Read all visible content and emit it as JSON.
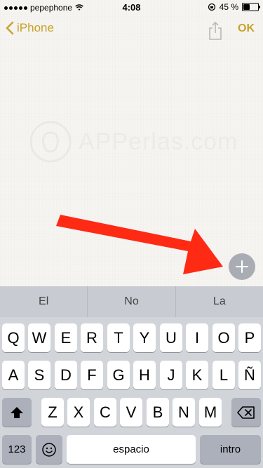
{
  "status_bar": {
    "carrier": "pepephone",
    "time": "4:08",
    "battery": "45 %"
  },
  "nav": {
    "back_label": "iPhone",
    "ok_label": "OK"
  },
  "watermark": {
    "text": "APPerlas.com"
  },
  "suggestions": [
    "El",
    "No",
    "La"
  ],
  "keyboard": {
    "row1": [
      "Q",
      "W",
      "E",
      "R",
      "T",
      "Y",
      "U",
      "I",
      "O",
      "P"
    ],
    "row2": [
      "A",
      "S",
      "D",
      "F",
      "G",
      "H",
      "J",
      "K",
      "L",
      "Ñ"
    ],
    "row3": [
      "Z",
      "X",
      "C",
      "V",
      "B",
      "N",
      "M"
    ],
    "numbers_label": "123",
    "space_label": "espacio",
    "return_label": "intro"
  },
  "icons": {
    "back": "chevron-left-icon",
    "share": "share-icon",
    "add": "plus-icon",
    "shift": "shift-icon",
    "delete": "delete-icon",
    "emoji": "emoji-icon"
  },
  "colors": {
    "accent": "#c8a32b",
    "arrow": "#ff2a14",
    "add_button": "#a9adb3"
  }
}
